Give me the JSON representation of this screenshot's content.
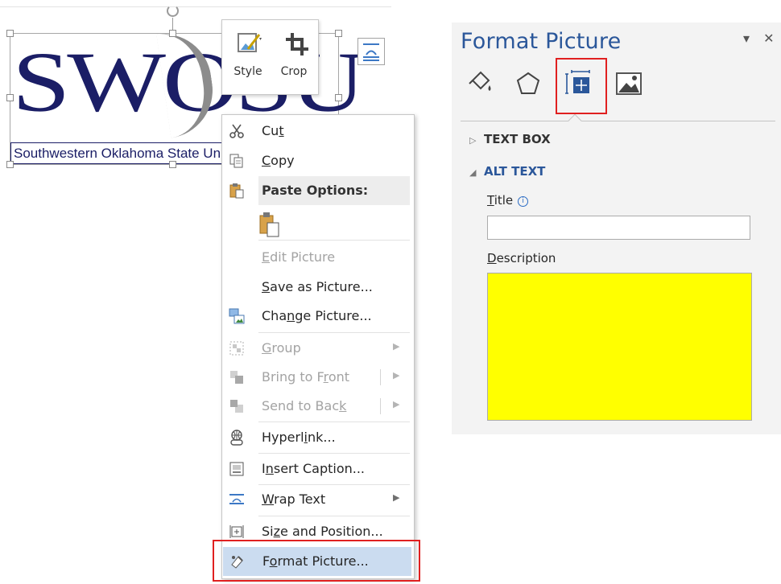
{
  "picture": {
    "logo_text": "SWOSU",
    "logo_subtitle": "Southwestern Oklahoma State University"
  },
  "mini_toolbar": {
    "style_label": "Style",
    "crop_label": "Crop"
  },
  "context_menu": {
    "cut": {
      "pre": "Cu",
      "key": "t",
      "post": ""
    },
    "copy": {
      "pre": "",
      "key": "C",
      "post": "opy"
    },
    "paste_options": "Paste Options:",
    "edit_picture": {
      "pre": "",
      "key": "E",
      "post": "dit Picture"
    },
    "save_as_picture": {
      "pre": "",
      "key": "S",
      "post": "ave as Picture..."
    },
    "change_picture": {
      "pre": "Cha",
      "key": "n",
      "post": "ge Picture..."
    },
    "group": {
      "pre": "",
      "key": "G",
      "post": "roup"
    },
    "bring_to_front": {
      "pre": "Bring to F",
      "key": "r",
      "post": "ont"
    },
    "send_to_back": {
      "pre": "Send to Bac",
      "key": "k",
      "post": ""
    },
    "hyperlink": {
      "pre": "Hyperl",
      "key": "i",
      "post": "nk..."
    },
    "insert_caption": {
      "pre": "I",
      "key": "n",
      "post": "sert Caption..."
    },
    "wrap_text": {
      "pre": "",
      "key": "W",
      "post": "rap Text"
    },
    "size_and_position": {
      "pre": "Si",
      "key": "z",
      "post": "e and Position..."
    },
    "format_picture": {
      "pre": "F",
      "key": "o",
      "post": "rmat Picture..."
    }
  },
  "pane": {
    "title": "Format Picture",
    "controls": "▾ ✕",
    "tabs": [
      "fill-line-icon",
      "effects-icon",
      "layout-properties-icon",
      "picture-icon"
    ],
    "active_tab": "layout-properties-icon",
    "text_box": {
      "toggle": "▷",
      "label": "TEXT BOX"
    },
    "alt_text": {
      "toggle": "◢",
      "label": "ALT TEXT"
    },
    "title_field": {
      "key": "T",
      "post": "itle",
      "value": ""
    },
    "description_field": {
      "key": "D",
      "post": "escription",
      "value": ""
    },
    "colors": {
      "accent": "#2b579a",
      "pane_bg": "#f3f3f3",
      "description_highlight": "#ffff00"
    }
  },
  "annotation_color": "#e02020"
}
